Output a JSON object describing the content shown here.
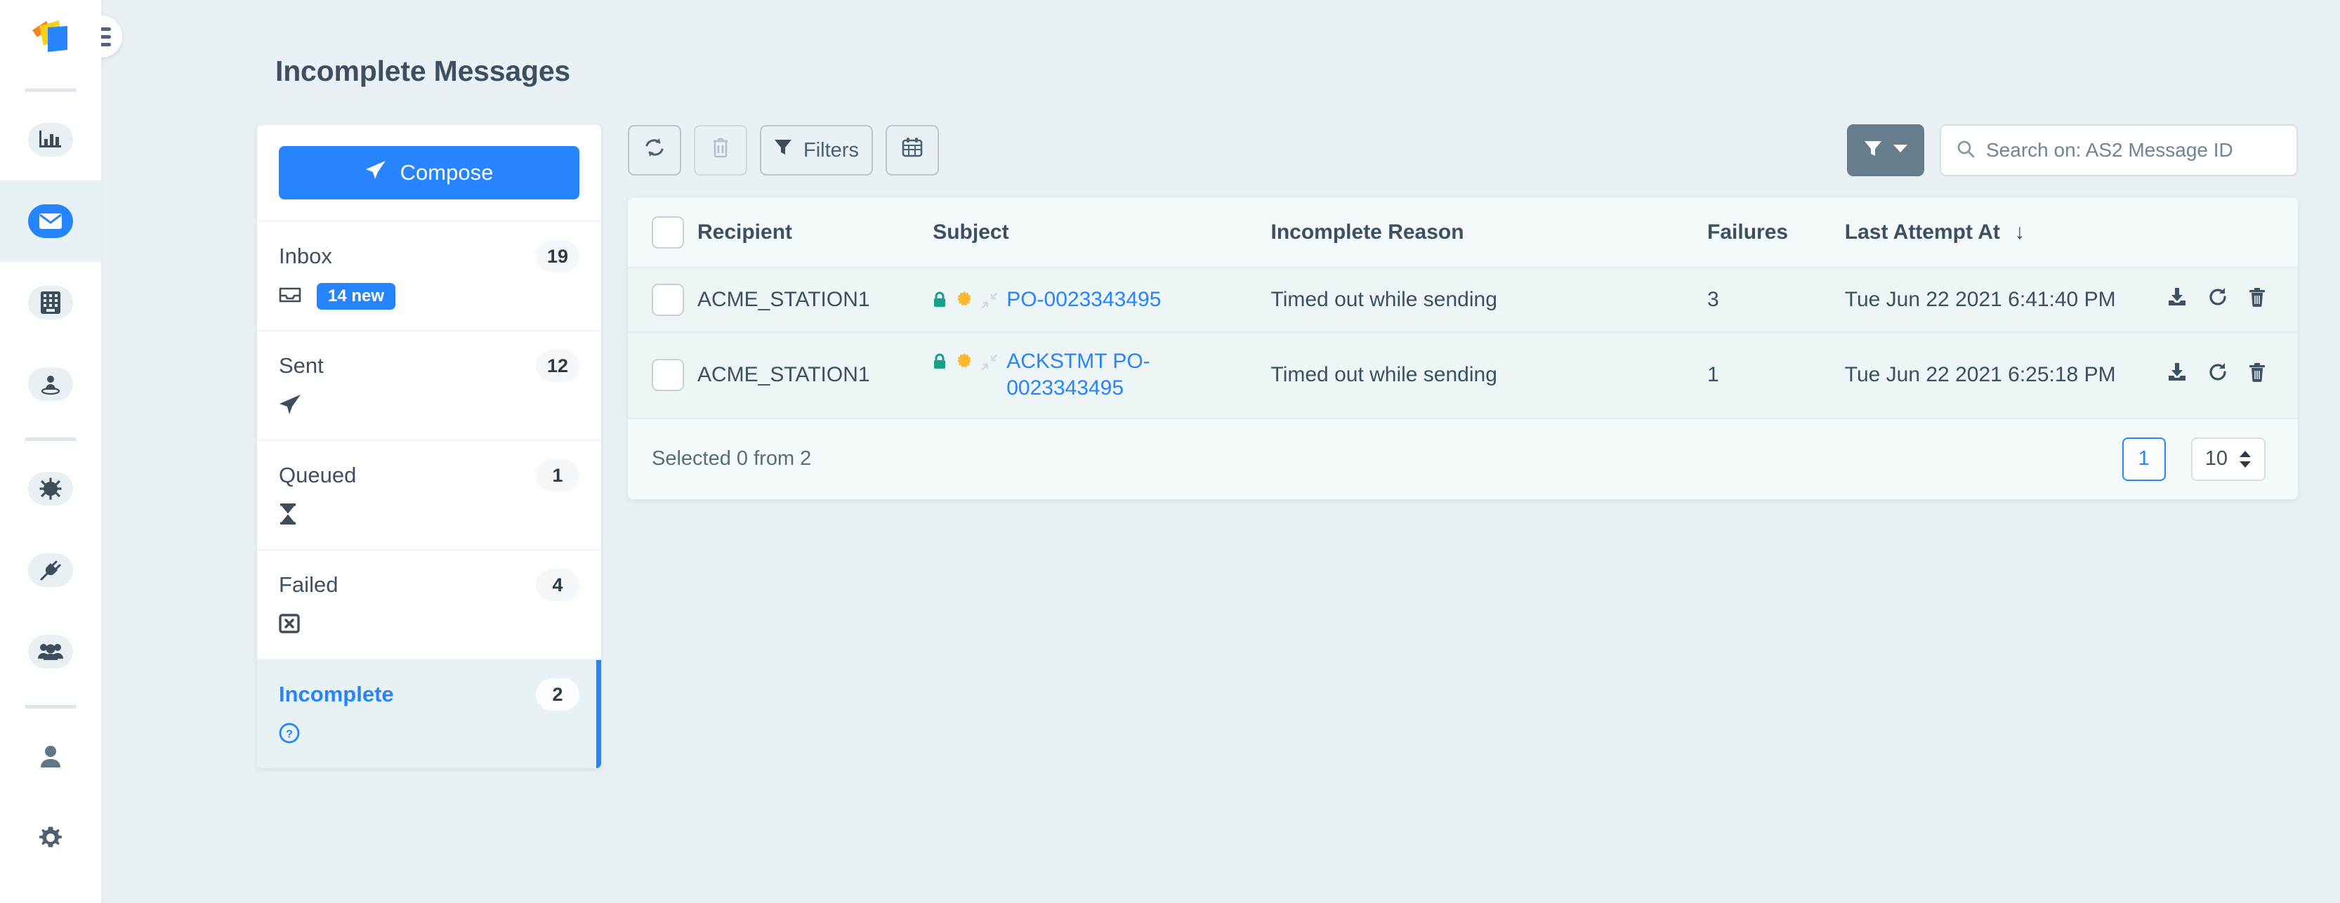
{
  "app": {
    "logo_icon": "pages-stack-logo",
    "hamburger_icon": "hamburger-menu-icon"
  },
  "rail": {
    "items": [
      {
        "icon": "bar-chart-icon",
        "name": "dashboard",
        "active": false
      },
      {
        "icon": "envelope-icon",
        "name": "messages",
        "active": true
      },
      {
        "icon": "keypad-icon",
        "name": "trading-partners",
        "active": false
      },
      {
        "icon": "user-location-icon",
        "name": "stations",
        "active": false
      },
      {
        "icon": "gear-cog-icon",
        "name": "configuration",
        "active": false
      },
      {
        "icon": "plug-icon",
        "name": "connectors",
        "active": false
      },
      {
        "icon": "users-group-icon",
        "name": "users",
        "active": false
      },
      {
        "icon": "person-icon",
        "name": "account",
        "active": false
      },
      {
        "icon": "settings-gear-icon",
        "name": "settings",
        "active": false
      }
    ]
  },
  "header": {
    "title": "Incomplete Messages"
  },
  "sidebar": {
    "compose_label": "Compose",
    "compose_icon": "paper-plane-icon",
    "items": [
      {
        "label": "Inbox",
        "count": "19",
        "icon": "inbox-tray-icon",
        "badge": "14 new",
        "active": false
      },
      {
        "label": "Sent",
        "count": "12",
        "icon": "paper-plane-icon",
        "badge": "",
        "active": false
      },
      {
        "label": "Queued",
        "count": "1",
        "icon": "hourglass-icon",
        "badge": "",
        "active": false
      },
      {
        "label": "Failed",
        "count": "4",
        "icon": "boxed-x-icon",
        "badge": "",
        "active": false
      },
      {
        "label": "Incomplete",
        "count": "2",
        "icon": "question-circle-icon",
        "badge": "",
        "active": true
      }
    ]
  },
  "toolbar": {
    "refresh_icon": "refresh-icon",
    "delete_icon": "trash-icon",
    "filters_label": "Filters",
    "filters_icon": "funnel-icon",
    "calendar_icon": "calendar-icon",
    "filter_dropdown_icon": "funnel-icon",
    "filter_caret_icon": "caret-down-icon",
    "search": {
      "icon": "search-icon",
      "placeholder": "Search on: AS2 Message ID",
      "value": ""
    }
  },
  "table": {
    "columns": [
      "Recipient",
      "Subject",
      "Incomplete Reason",
      "Failures",
      "Last Attempt At"
    ],
    "sort_column": "Last Attempt At",
    "sort_icon": "arrow-down-icon",
    "header_checkbox_name": "select-all-checkbox",
    "rows": [
      {
        "recipient": "ACME_STATION1",
        "subject": "PO-0023343495",
        "icons": [
          "lock-icon",
          "certificate-seal-icon",
          "compress-arrows-icon"
        ],
        "reason": "Timed out while sending",
        "failures": "3",
        "last_attempt": "Tue Jun 22 2021 6:41:40 PM",
        "actions": [
          "download-icon",
          "retry-icon",
          "trash-icon"
        ]
      },
      {
        "recipient": "ACME_STATION1",
        "subject": "ACKSTMT PO-0023343495",
        "icons": [
          "lock-icon",
          "certificate-seal-icon",
          "compress-arrows-icon"
        ],
        "reason": "Timed out while sending",
        "failures": "1",
        "last_attempt": "Tue Jun 22 2021 6:25:18 PM",
        "actions": [
          "download-icon",
          "retry-icon",
          "trash-icon"
        ]
      }
    ]
  },
  "footer": {
    "selection_text": "Selected 0 from 2",
    "current_page": "1",
    "page_size": "10"
  },
  "colors": {
    "accent_blue": "#2684ff",
    "page_bg": "#eaf1f4",
    "card_bg": "#ffffff",
    "table_bg": "#eef5f7",
    "text_dark": "#3d4f61",
    "lock_green": "#16a085",
    "seal_orange": "#fcb731",
    "filter_btn_gray": "#687d8c"
  }
}
